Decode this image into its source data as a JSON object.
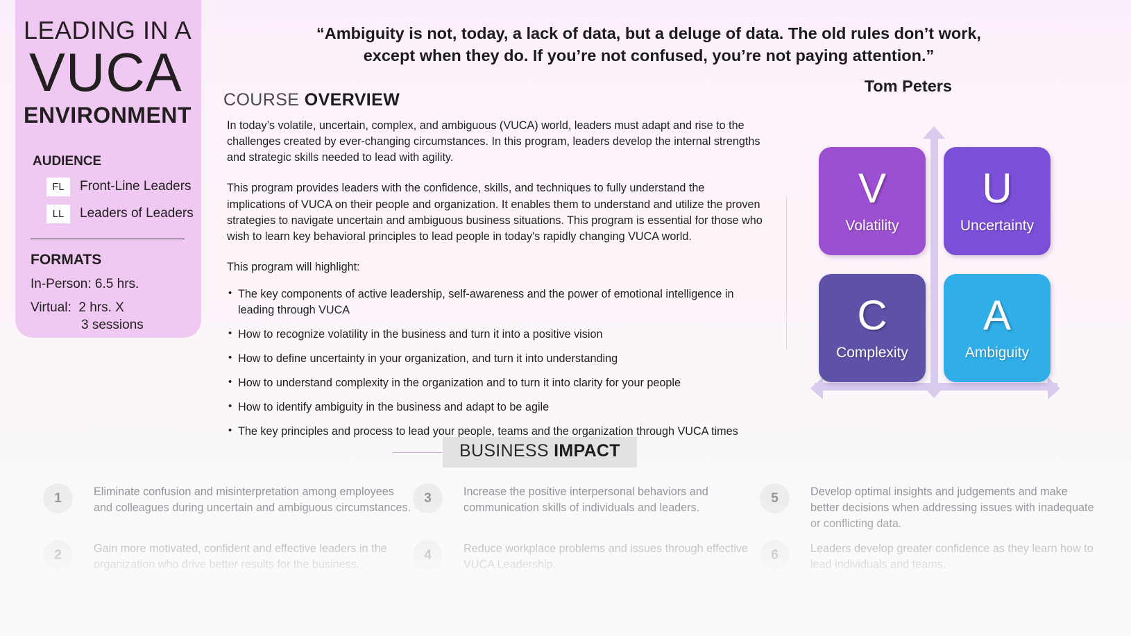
{
  "sidebar": {
    "title_line1": "LEADING IN A",
    "title_main": "VUCA",
    "title_line3": "ENVIRONMENT",
    "audience_heading": "AUDIENCE",
    "audience": [
      {
        "badge": "FL",
        "label": "Front-Line Leaders"
      },
      {
        "badge": "LL",
        "label": "Leaders of Leaders"
      }
    ],
    "formats_heading": "FORMATS",
    "formats": {
      "in_person": "In-Person: 6.5 hrs.",
      "virtual": "Virtual:  2 hrs. X",
      "virtual_cont": "3 sessions"
    },
    "bg_color": "#efc9f2"
  },
  "quote": {
    "text": "“Ambiguity is not, today, a lack of data, but a deluge of data. The old rules don’t work, except when they do. If you’re not confused, you’re not paying attention.”",
    "author": "Tom Peters"
  },
  "overview": {
    "heading_light": "COURSE ",
    "heading_bold": "OVERVIEW",
    "paragraph1": "In today’s volatile, uncertain, complex, and ambiguous (VUCA) world, leaders must adapt and rise to the challenges created by ever-changing circumstances. In this program, leaders develop the internal strengths and strategic skills needed to lead with agility.",
    "paragraph2": "This program provides leaders with the confidence, skills, and techniques to fully understand the implications of VUCA on their people and organization.  It enables them to understand and utilize the proven strategies to navigate uncertain and ambiguous business situations. This program is essential for those who wish to learn key behavioral principles to lead people in today's rapidly changing VUCA world.",
    "highlight_intro": "This program will highlight:",
    "bullets": [
      "The key components of active leadership, self-awareness and the power of emotional intelligence in leading through VUCA",
      "How to recognize volatility in the business and turn it into a positive vision",
      "How to define uncertainty in your organization, and turn it into understanding",
      "How to understand complexity in the organization and to turn it into clarity for your people",
      "How to identify ambiguity in the business and adapt to be agile",
      "The key principles and process to lead your people, teams and the organization through VUCA times"
    ]
  },
  "vuca_diagram": {
    "tiles": [
      {
        "letter": "V",
        "word": "Volatility",
        "color": "#9c4fd0"
      },
      {
        "letter": "U",
        "word": "Uncertainty",
        "color": "#7b4fd8"
      },
      {
        "letter": "C",
        "word": "Complexity",
        "color": "#5d52a8"
      },
      {
        "letter": "A",
        "word": "Ambiguity",
        "color": "#2faee8"
      }
    ],
    "axis_color": "#d8cbee"
  },
  "business_impact": {
    "heading_light": "BUSINESS ",
    "heading_bold": "IMPACT",
    "items": [
      {
        "number": "1",
        "text": "Eliminate confusion and misinterpretation among employees and colleagues during uncertain and ambiguous circumstances."
      },
      {
        "number": "3",
        "text": "Increase the positive interpersonal behaviors and communication skills of individuals and leaders."
      },
      {
        "number": "5",
        "text": "Develop optimal insights and judgements and make better decisions when addressing issues with inadequate or conflicting data."
      },
      {
        "number": "2",
        "text": "Gain more motivated, confident and effective leaders in the organization who drive better results for the business."
      },
      {
        "number": "4",
        "text": "Reduce workplace problems and issues through effective VUCA Leadership."
      },
      {
        "number": "6",
        "text": "Leaders develop greater confidence as they learn how to lead individuals and teams."
      }
    ]
  }
}
